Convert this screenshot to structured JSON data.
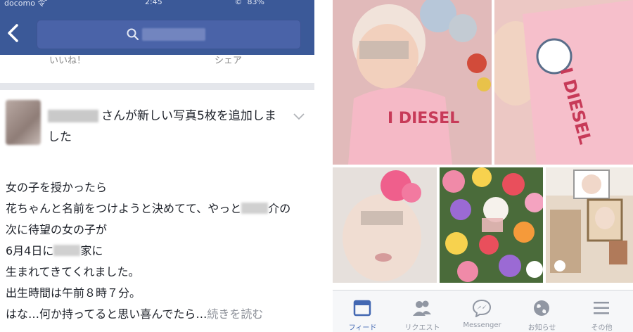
{
  "status_bar": {
    "carrier": "docomo 令 ̄",
    "time": "2:45",
    "battery": "́ © ́ 83%"
  },
  "nav": {
    "search_placeholder": ""
  },
  "previous_post_actions": {
    "like": "いいね！",
    "share": "シェア"
  },
  "post": {
    "header_text": "さんが新しい写真5枚を追加しました",
    "body_lines": [
      "女の子を授かったら",
      "花ちゃんと名前をつけようと決めてて、やっと",
      "介の",
      "次に待望の女の子が",
      "6月4日に",
      "家に",
      "生まれてきてくれました。",
      "出生時間は午前８時７分。",
      "はな…何か持ってると思い喜んでたら…",
      "続きを読む"
    ]
  },
  "photos": [
    {
      "id": "photo-1",
      "shirt_text": "I DIESEL"
    },
    {
      "id": "photo-2",
      "shirt_text": "I DIESEL"
    },
    {
      "id": "photo-3"
    },
    {
      "id": "photo-4"
    },
    {
      "id": "photo-5"
    }
  ],
  "tabbar": {
    "active_color": "#4267b2",
    "inactive_color": "#9197a3",
    "items": [
      {
        "label": "フィード",
        "icon": "feed-icon",
        "active": true
      },
      {
        "label": "リクエスト",
        "icon": "friend-requests-icon",
        "active": false
      },
      {
        "label": "Messenger",
        "icon": "messenger-icon",
        "active": false
      },
      {
        "label": "お知らせ",
        "icon": "globe-icon",
        "active": false
      },
      {
        "label": "その他",
        "icon": "menu-icon",
        "active": false
      }
    ]
  },
  "colors": {
    "facebook_blue": "#3b5998",
    "text": "#1d2129",
    "muted": "#90949c"
  }
}
